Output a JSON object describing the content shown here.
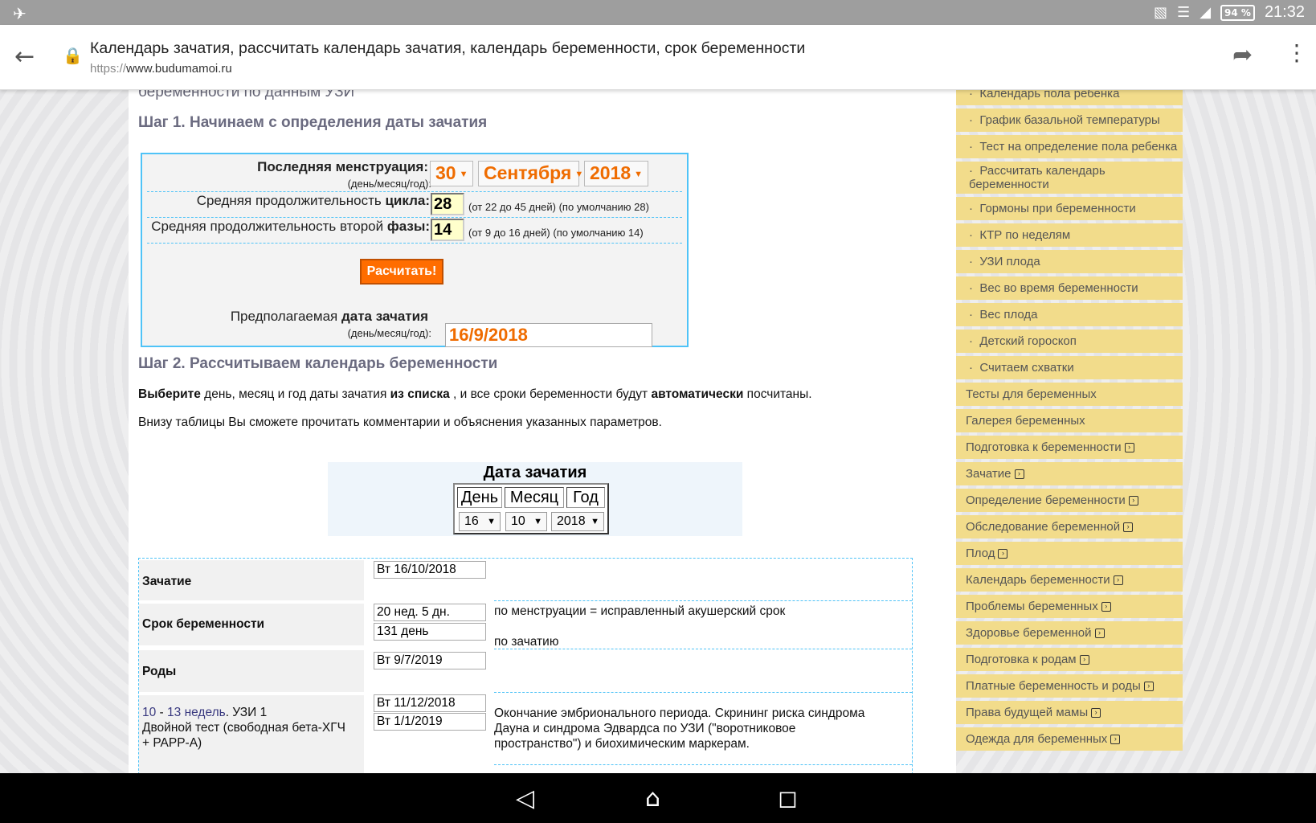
{
  "status_bar": {
    "battery": "94 %",
    "time": "21:32"
  },
  "browser": {
    "title": "Календарь зачатия, рассчитать календарь зачатия, календарь беременности, срок беременности",
    "url_protocol": "https://",
    "url_domain": "www.budumamoi.ru"
  },
  "page": {
    "crumb_text": "беременности по данным УЗИ",
    "step1_heading": "Шаг 1. Начинаем с определения даты зачатия",
    "calc": {
      "last_period_label": "Последняя менструация:",
      "last_period_hint": "(день/месяц/год):",
      "day": "30",
      "month": "Сентября",
      "year": "2018",
      "cycle_label_plain": "Средняя продолжительность ",
      "cycle_label_bold": "цикла:",
      "cycle_value": "28",
      "cycle_hint": "(от 22 до 45 дней) (по умолчанию 28)",
      "phase_label_plain": "Средняя продолжительность второй ",
      "phase_label_bold": "фазы:",
      "phase_value": "14",
      "phase_hint": "(от 9 до 16 дней) (по умолчанию 14)",
      "button": "Расчитать!",
      "result_label_plain": "Предполагаемая ",
      "result_label_bold": "дата зачатия",
      "result_hint": "(день/месяц/год):",
      "result_value": "16/9/2018"
    },
    "step2_heading": "Шаг 2. Рассчитываем календарь беременности",
    "para1": {
      "b1": "Выберите",
      "t1": " день, месяц и год даты зачатия ",
      "b2": "из списка",
      "t2": " , и все сроки беременности будут ",
      "b3": "автоматически",
      "t3": " посчитаны."
    },
    "para2": "Внизу таблицы Вы сможете прочитать комментарии и объяснения указанных параметров.",
    "conception": {
      "caption": "Дата зачатия",
      "col_day": "День",
      "col_month": "Месяц",
      "col_year": "Год",
      "day": "16",
      "month": "10",
      "year": "2018"
    },
    "results": {
      "conception_label": "Зачатие",
      "conception_value": "Вт 16/10/2018",
      "term_label": "Срок беременности",
      "term_value1": "20 нед. 5 дн.",
      "term_value2": "131 день",
      "term_note1": "по менструации = исправленный акушерский срок",
      "term_note2": "по зачатию",
      "birth_label": "Роды",
      "birth_value": "Вт 9/7/2019",
      "us1_link_a": "10",
      "us1_dash": " - ",
      "us1_link_b": "13 недель",
      "us1_label": ". УЗИ 1",
      "us1_label2": "Двойной тест (свободная бета-ХГЧ",
      "us1_label3": "+ PAPP-A)",
      "us1_value1": "Вт 11/12/2018",
      "us1_value2": "Вт 1/1/2019",
      "us1_note1": "Окончание эмбрионального периода. Скрининг риска синдрома",
      "us1_note2": "Дауна и синдрома Эдвардса по УЗИ (\"воротниковое",
      "us1_note3": "пространство\") и биохимическим маркерам."
    }
  },
  "sidebar": [
    {
      "label": "Календарь пола ребенка",
      "sub": true
    },
    {
      "label": "График базальной температуры",
      "sub": true
    },
    {
      "label": "Тест на определение пола ребенка",
      "sub": true
    },
    {
      "label": "Рассчитать календарь беременности",
      "sub": true,
      "two": true
    },
    {
      "label": "Гормоны при беременности",
      "sub": true
    },
    {
      "label": "КТР по неделям",
      "sub": true
    },
    {
      "label": "УЗИ плода",
      "sub": true
    },
    {
      "label": "Вес во время беременности",
      "sub": true
    },
    {
      "label": "Вес плода",
      "sub": true
    },
    {
      "label": "Детский гороскоп",
      "sub": true
    },
    {
      "label": "Считаем схватки",
      "sub": true
    },
    {
      "label": "Тесты для беременных"
    },
    {
      "label": "Галерея беременных"
    },
    {
      "label": "Подготовка к беременности",
      "plus": true
    },
    {
      "label": "Зачатие",
      "plus": true
    },
    {
      "label": "Определение беременности",
      "plus": true
    },
    {
      "label": "Обследование беременной",
      "plus": true
    },
    {
      "label": "Плод",
      "plus": true
    },
    {
      "label": "Календарь беременности",
      "plus": true
    },
    {
      "label": "Проблемы беременных",
      "plus": true
    },
    {
      "label": "Здоровье беременной",
      "plus": true
    },
    {
      "label": "Подготовка к родам",
      "plus": true
    },
    {
      "label": "Платные беременность и роды",
      "plus": true
    },
    {
      "label": "Права будущей мамы",
      "plus": true
    },
    {
      "label": "Одежда для беременных",
      "plus": true
    }
  ]
}
